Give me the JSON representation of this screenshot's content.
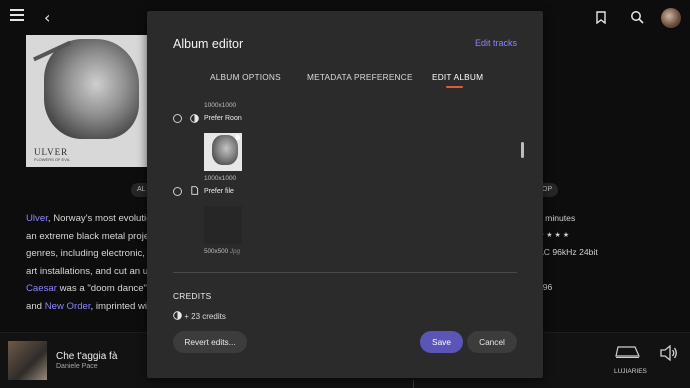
{
  "background": {
    "cover_band": "ULVER",
    "cover_subtitle": "FLOWERS OF EVIL",
    "pills": [
      "AL",
      "OP"
    ],
    "bio_lines": [
      {
        "pre": "",
        "link": "Ulver",
        "post": ", Norway's most evolution"
      },
      {
        "pre": "an extreme black metal project",
        "link": "",
        "post": ""
      },
      {
        "pre": "genres, including electronic, in",
        "link": "",
        "post": ""
      },
      {
        "pre": "art installations, and cut an unc",
        "link": "",
        "post": ""
      },
      {
        "pre": "",
        "link": "Caesar",
        "post": " was a \"doom dance\" of"
      },
      {
        "pre": "and ",
        "link": "New Order",
        "post": ", imprinted with"
      }
    ],
    "meta_lines": [
      "7 minutes",
      "★★★★",
      "AC 96kHz 24bit",
      "8",
      "–96"
    ]
  },
  "modal": {
    "title": "Album editor",
    "edit_tracks": "Edit tracks",
    "tabs": [
      "ALBUM OPTIONS",
      "METADATA PREFERENCE",
      "EDIT ALBUM"
    ],
    "active_tab": "EDIT ALBUM",
    "options": {
      "top_resolution": "1000x1000",
      "prefer_roon_label": "Prefer Roon",
      "roon_resolution": "1000x1000",
      "prefer_file_label": "Prefer file",
      "file_resolution": "500x500",
      "file_ext": "Jpg"
    },
    "credits_heading": "CREDITS",
    "credits_summary": "+  23 credits",
    "buttons": {
      "revert": "Revert edits...",
      "save": "Save",
      "cancel": "Cancel"
    }
  },
  "now_playing": {
    "title": "Che t'aggia fà",
    "artist": "Daniele Pace",
    "zone": "LUJIARIES"
  },
  "colors": {
    "accent": "#8c84ff",
    "save_button": "#5b55b8",
    "tab_underline": "#e05a3a",
    "modal_bg": "#2b2b2b"
  }
}
